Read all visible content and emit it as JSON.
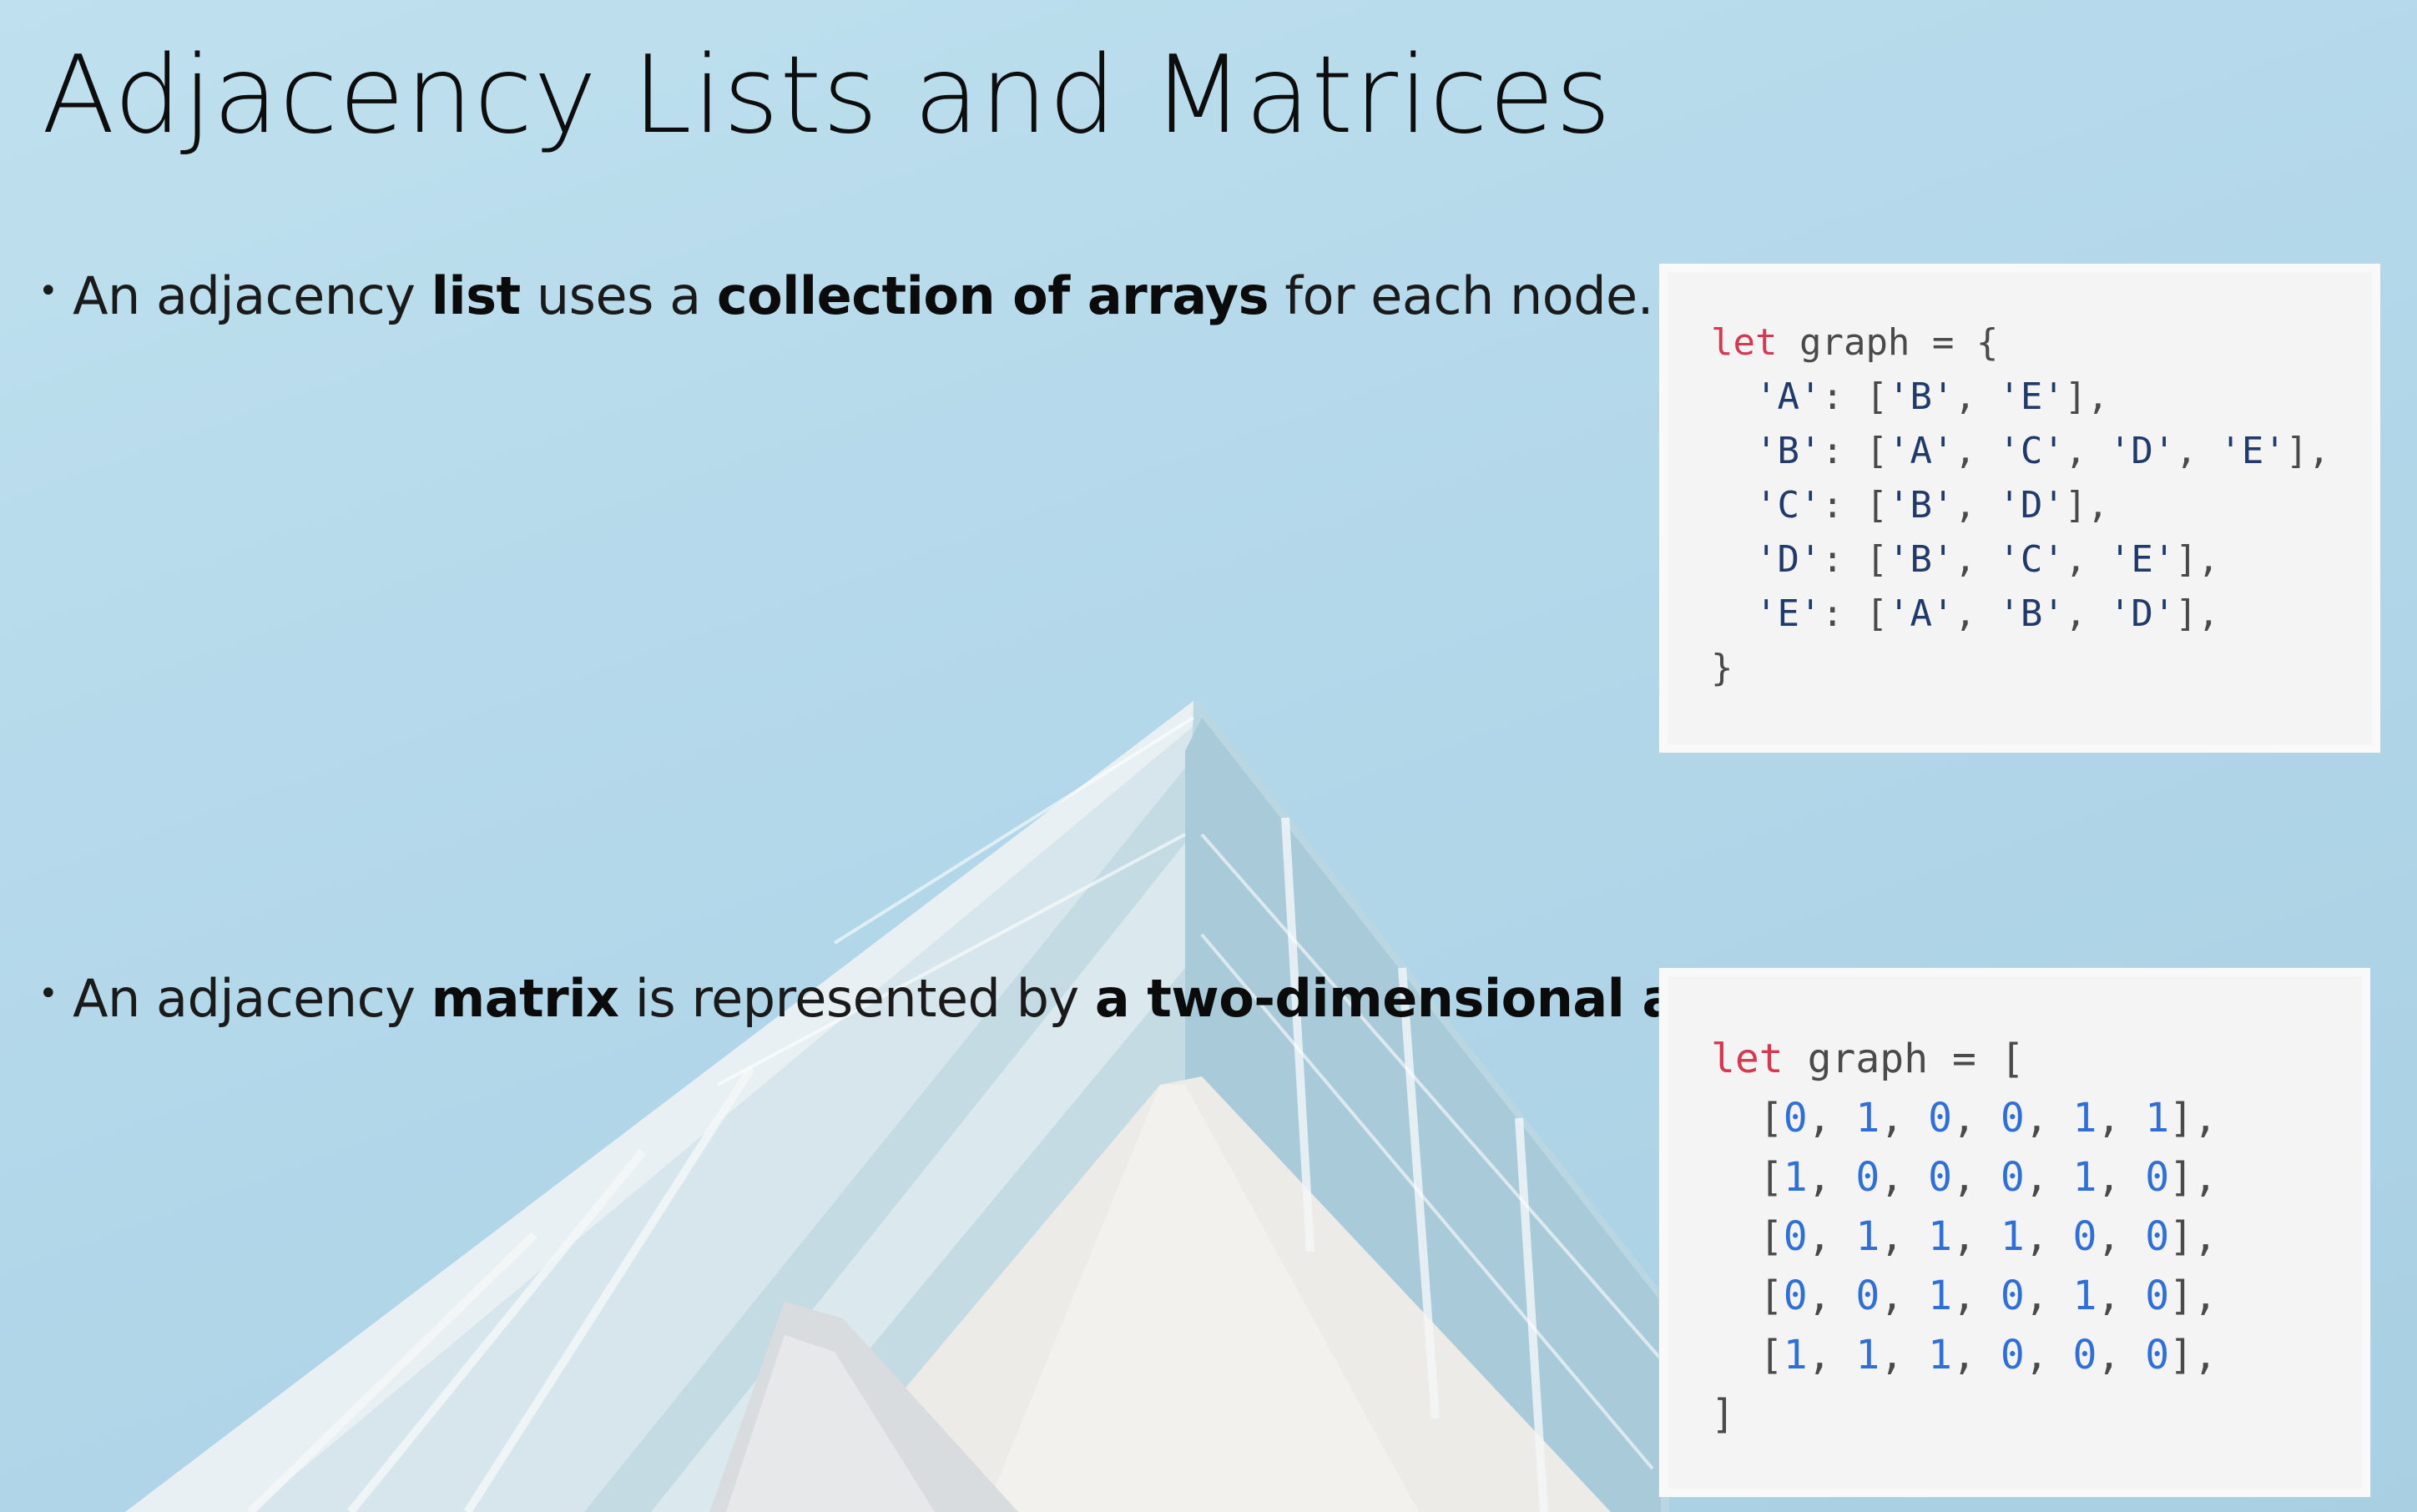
{
  "slide": {
    "title": "Adjacency Lists and Matrices",
    "bullets": [
      {
        "parts": [
          {
            "text": "An adjacency ",
            "bold": false
          },
          {
            "text": "list",
            "bold": true
          },
          {
            "text": " uses a ",
            "bold": false
          },
          {
            "text": "collection of arrays",
            "bold": true
          },
          {
            "text": " for each node.",
            "bold": false
          }
        ]
      },
      {
        "parts": [
          {
            "text": "An adjacency ",
            "bold": false
          },
          {
            "text": "matrix",
            "bold": true
          },
          {
            "text": " is represented by ",
            "bold": false
          },
          {
            "text": "a two-dimensional array",
            "bold": true
          },
          {
            "text": ".",
            "bold": false
          }
        ]
      }
    ],
    "bullet_glyph": "•"
  },
  "code_list": {
    "lines": [
      "let graph = {",
      "  'A': ['B', 'E'],",
      "  'B': ['A', 'C', 'D', 'E'],",
      "  'C': ['B', 'D'],",
      "  'D': ['B', 'C', 'E'],",
      "  'E': ['A', 'B', 'D'],",
      "}"
    ]
  },
  "code_matrix": {
    "lines": [
      "let graph = [",
      "  [0, 1, 0, 0, 1, 1],",
      "  [1, 0, 0, 0, 1, 0],",
      "  [0, 1, 1, 1, 0, 0],",
      "  [0, 0, 1, 0, 1, 0],",
      "  [1, 1, 1, 0, 0, 0],",
      "]"
    ]
  },
  "colors": {
    "keyword": "#d23a52",
    "string": "#1f3a6b",
    "number": "#2f6fd6",
    "background_sky": "#b3d8ea"
  }
}
